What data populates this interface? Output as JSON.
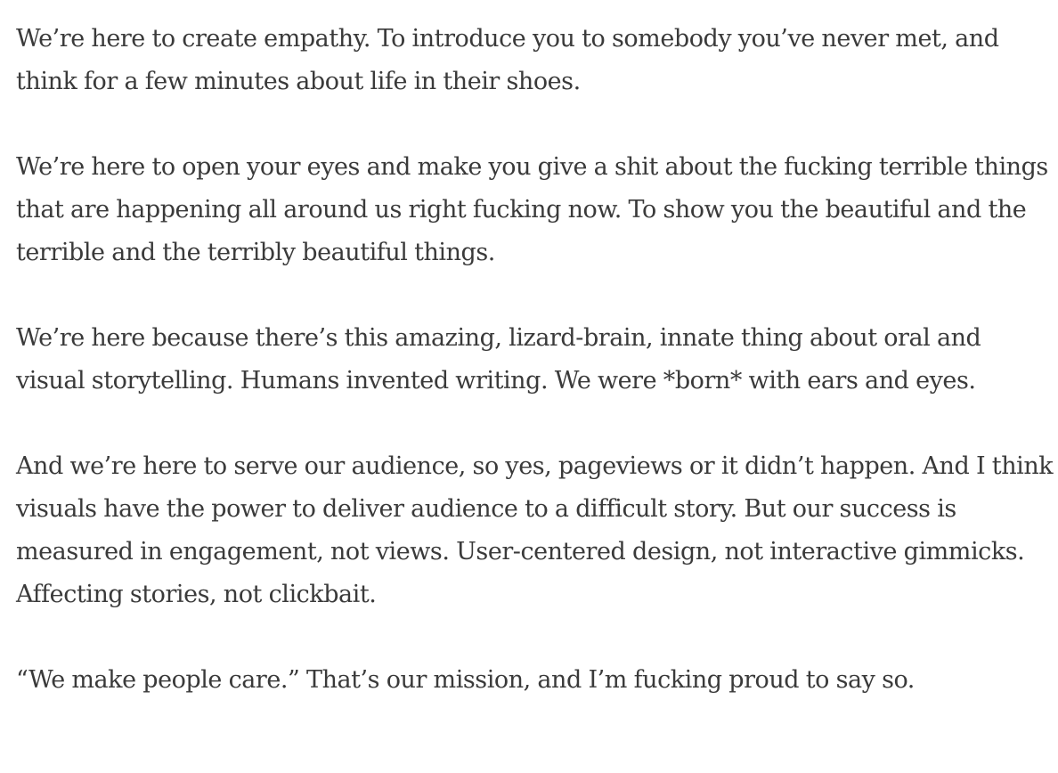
{
  "article": {
    "paragraphs": [
      "We’re here to create empathy. To introduce you to somebody you’ve never met, and think for a few minutes about life in their shoes.",
      "We’re here to open your eyes and make you give a shit about the fucking terrible things that are happening all around us right fucking now. To show you the beautiful and the terrible and the terribly beautiful things.",
      "We’re here because there’s this amazing, lizard-brain, innate thing about oral and visual storytelling. Humans invented writing. We were *born* with ears and eyes.",
      "And we’re here to serve our audience, so yes, pageviews or it didn’t happen. And I think visuals have the power to deliver audience to a difficult story. But our success is measured in engagement, not views. User-centered design, not interactive gimmicks. Affecting stories, not clickbait.",
      "“We make people care.” That’s our mission, and I’m fucking proud to say so."
    ]
  },
  "colors": {
    "text": "#3a3a3a",
    "background": "#ffffff"
  }
}
